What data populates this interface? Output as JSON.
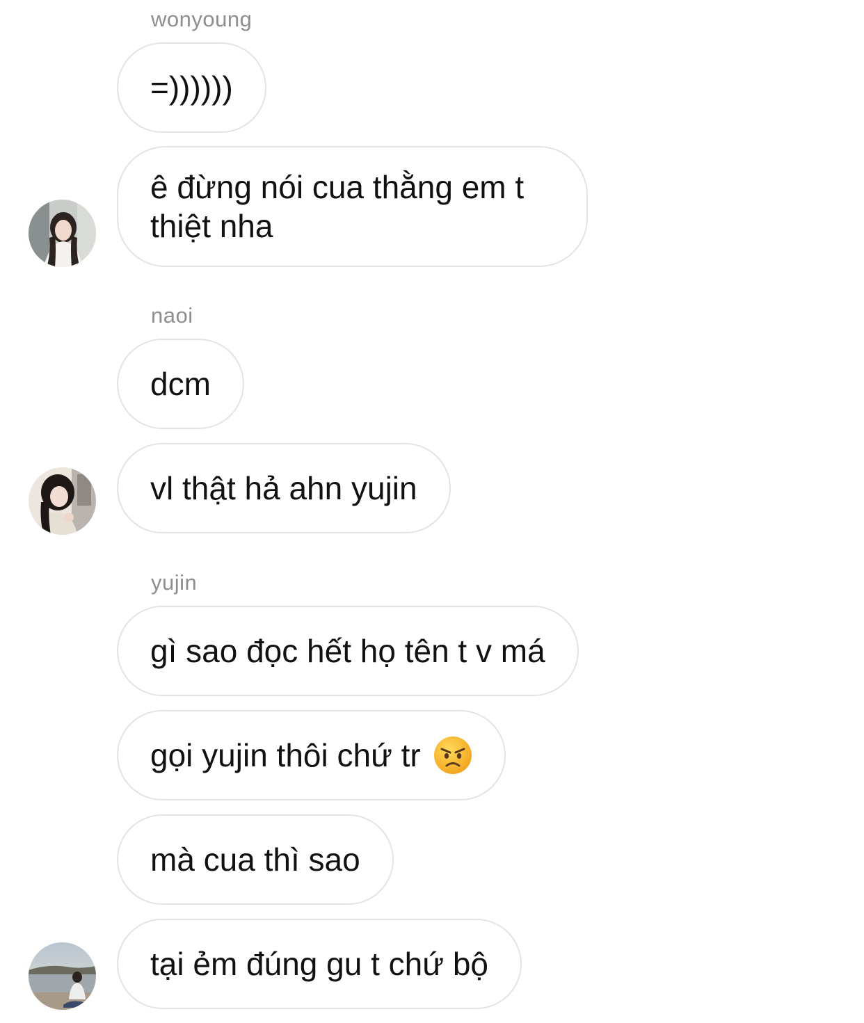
{
  "groups": [
    {
      "sender": "wonyoung",
      "messages": [
        "=))))))",
        "ê đừng nói cua thằng em t thiệt nha"
      ]
    },
    {
      "sender": "naoi",
      "messages": [
        "dcm",
        "vl thật hả ahn yujin"
      ]
    },
    {
      "sender": "yujin",
      "messages": [
        "gì sao đọc hết họ tên t v má",
        "gọi yujin thôi chứ tr",
        "mà cua thì sao",
        "tại ẻm đúng gu t chứ bộ"
      ]
    }
  ],
  "icons": {
    "angry_emoji": "angry-face-emoji",
    "avatars": [
      "user-avatar",
      "user-avatar",
      "user-avatar"
    ]
  },
  "colors": {
    "sender_text": "#8e8e8e",
    "bubble_border": "#e3e3e3",
    "message_text": "#111111",
    "emoji_face": "#f7b733"
  }
}
